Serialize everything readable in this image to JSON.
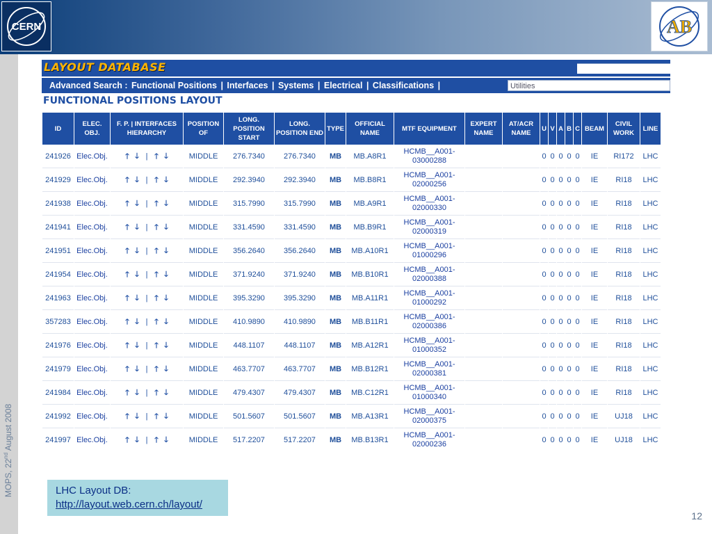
{
  "side_label": {
    "prefix": "MOPS, 22",
    "sup": "nd",
    "suffix": " August 2008"
  },
  "logos": {
    "left": "CERN",
    "right": "AB"
  },
  "app": {
    "title": "LAYOUT DATABASE",
    "nav": [
      "Advanced Search :",
      "Functional Positions",
      "|",
      "Interfaces",
      "|",
      "Systems",
      "|",
      "Electrical",
      "|",
      "Classifications",
      "|"
    ],
    "utilities_value": "Utilities",
    "section_title": "FUNCTIONAL POSITIONS LAYOUT"
  },
  "table": {
    "headers": [
      "ID",
      "ELEC. OBJ.",
      "F. P. | INTERFACES HIERARCHY",
      "POSITION OF",
      "LONG. POSITION START",
      "LONG. POSITION END",
      "TYPE",
      "OFFICIAL NAME",
      "MTF EQUIPMENT",
      "EXPERT NAME",
      "AT/ACR NAME",
      "U",
      "V",
      "A",
      "B",
      "C",
      "BEAM",
      "CIVIL WORK",
      "LINE"
    ],
    "hierarchy_glyphs": {
      "up": "🡑",
      "down": "🡓",
      "sep": "|"
    },
    "rows": [
      {
        "id": "241926",
        "elec": "Elec.Obj.",
        "pos": "MIDDLE",
        "start": "276.7340",
        "end": "276.7340",
        "type": "MB",
        "name": "MB.A8R1",
        "mtf": "HCMB__A001-03000288",
        "expert": "",
        "atacr": "",
        "u": "0",
        "v": "0",
        "a": "0",
        "b": "0",
        "c": "0",
        "beam": "IE",
        "civil": "RI172",
        "line": "LHC"
      },
      {
        "id": "241929",
        "elec": "Elec.Obj.",
        "pos": "MIDDLE",
        "start": "292.3940",
        "end": "292.3940",
        "type": "MB",
        "name": "MB.B8R1",
        "mtf": "HCMB__A001-02000256",
        "expert": "",
        "atacr": "",
        "u": "0",
        "v": "0",
        "a": "0",
        "b": "0",
        "c": "0",
        "beam": "IE",
        "civil": "RI18",
        "line": "LHC"
      },
      {
        "id": "241938",
        "elec": "Elec.Obj.",
        "pos": "MIDDLE",
        "start": "315.7990",
        "end": "315.7990",
        "type": "MB",
        "name": "MB.A9R1",
        "mtf": "HCMB__A001-02000330",
        "expert": "",
        "atacr": "",
        "u": "0",
        "v": "0",
        "a": "0",
        "b": "0",
        "c": "0",
        "beam": "IE",
        "civil": "RI18",
        "line": "LHC"
      },
      {
        "id": "241941",
        "elec": "Elec.Obj.",
        "pos": "MIDDLE",
        "start": "331.4590",
        "end": "331.4590",
        "type": "MB",
        "name": "MB.B9R1",
        "mtf": "HCMB__A001-02000319",
        "expert": "",
        "atacr": "",
        "u": "0",
        "v": "0",
        "a": "0",
        "b": "0",
        "c": "0",
        "beam": "IE",
        "civil": "RI18",
        "line": "LHC"
      },
      {
        "id": "241951",
        "elec": "Elec.Obj.",
        "pos": "MIDDLE",
        "start": "356.2640",
        "end": "356.2640",
        "type": "MB",
        "name": "MB.A10R1",
        "mtf": "HCMB__A001-01000296",
        "expert": "",
        "atacr": "",
        "u": "0",
        "v": "0",
        "a": "0",
        "b": "0",
        "c": "0",
        "beam": "IE",
        "civil": "RI18",
        "line": "LHC"
      },
      {
        "id": "241954",
        "elec": "Elec.Obj.",
        "pos": "MIDDLE",
        "start": "371.9240",
        "end": "371.9240",
        "type": "MB",
        "name": "MB.B10R1",
        "mtf": "HCMB__A001-02000388",
        "expert": "",
        "atacr": "",
        "u": "0",
        "v": "0",
        "a": "0",
        "b": "0",
        "c": "0",
        "beam": "IE",
        "civil": "RI18",
        "line": "LHC"
      },
      {
        "id": "241963",
        "elec": "Elec.Obj.",
        "pos": "MIDDLE",
        "start": "395.3290",
        "end": "395.3290",
        "type": "MB",
        "name": "MB.A11R1",
        "mtf": "HCMB__A001-01000292",
        "expert": "",
        "atacr": "",
        "u": "0",
        "v": "0",
        "a": "0",
        "b": "0",
        "c": "0",
        "beam": "IE",
        "civil": "RI18",
        "line": "LHC"
      },
      {
        "id": "357283",
        "elec": "Elec.Obj.",
        "pos": "MIDDLE",
        "start": "410.9890",
        "end": "410.9890",
        "type": "MB",
        "name": "MB.B11R1",
        "mtf": "HCMB__A001-02000386",
        "expert": "",
        "atacr": "",
        "u": "0",
        "v": "0",
        "a": "0",
        "b": "0",
        "c": "0",
        "beam": "IE",
        "civil": "RI18",
        "line": "LHC"
      },
      {
        "id": "241976",
        "elec": "Elec.Obj.",
        "pos": "MIDDLE",
        "start": "448.1107",
        "end": "448.1107",
        "type": "MB",
        "name": "MB.A12R1",
        "mtf": "HCMB__A001-01000352",
        "expert": "",
        "atacr": "",
        "u": "0",
        "v": "0",
        "a": "0",
        "b": "0",
        "c": "0",
        "beam": "IE",
        "civil": "RI18",
        "line": "LHC"
      },
      {
        "id": "241979",
        "elec": "Elec.Obj.",
        "pos": "MIDDLE",
        "start": "463.7707",
        "end": "463.7707",
        "type": "MB",
        "name": "MB.B12R1",
        "mtf": "HCMB__A001-02000381",
        "expert": "",
        "atacr": "",
        "u": "0",
        "v": "0",
        "a": "0",
        "b": "0",
        "c": "0",
        "beam": "IE",
        "civil": "RI18",
        "line": "LHC"
      },
      {
        "id": "241984",
        "elec": "Elec.Obj.",
        "pos": "MIDDLE",
        "start": "479.4307",
        "end": "479.4307",
        "type": "MB",
        "name": "MB.C12R1",
        "mtf": "HCMB__A001-01000340",
        "expert": "",
        "atacr": "",
        "u": "0",
        "v": "0",
        "a": "0",
        "b": "0",
        "c": "0",
        "beam": "IE",
        "civil": "RI18",
        "line": "LHC"
      },
      {
        "id": "241992",
        "elec": "Elec.Obj.",
        "pos": "MIDDLE",
        "start": "501.5607",
        "end": "501.5607",
        "type": "MB",
        "name": "MB.A13R1",
        "mtf": "HCMB__A001-02000375",
        "expert": "",
        "atacr": "",
        "u": "0",
        "v": "0",
        "a": "0",
        "b": "0",
        "c": "0",
        "beam": "IE",
        "civil": "UJ18",
        "line": "LHC"
      },
      {
        "id": "241997",
        "elec": "Elec.Obj.",
        "pos": "MIDDLE",
        "start": "517.2207",
        "end": "517.2207",
        "type": "MB",
        "name": "MB.B13R1",
        "mtf": "HCMB__A001-02000236",
        "expert": "",
        "atacr": "",
        "u": "0",
        "v": "0",
        "a": "0",
        "b": "0",
        "c": "0",
        "beam": "IE",
        "civil": "UJ18",
        "line": "LHC"
      }
    ]
  },
  "caption": {
    "title": "LHC Layout DB:",
    "link": "http://layout.web.cern.ch/layout/"
  },
  "slide_number": "12",
  "colors": {
    "app_blue": "#1f4fa3",
    "title_orange": "#ffb400",
    "caption_bg": "#a8d8e1"
  }
}
